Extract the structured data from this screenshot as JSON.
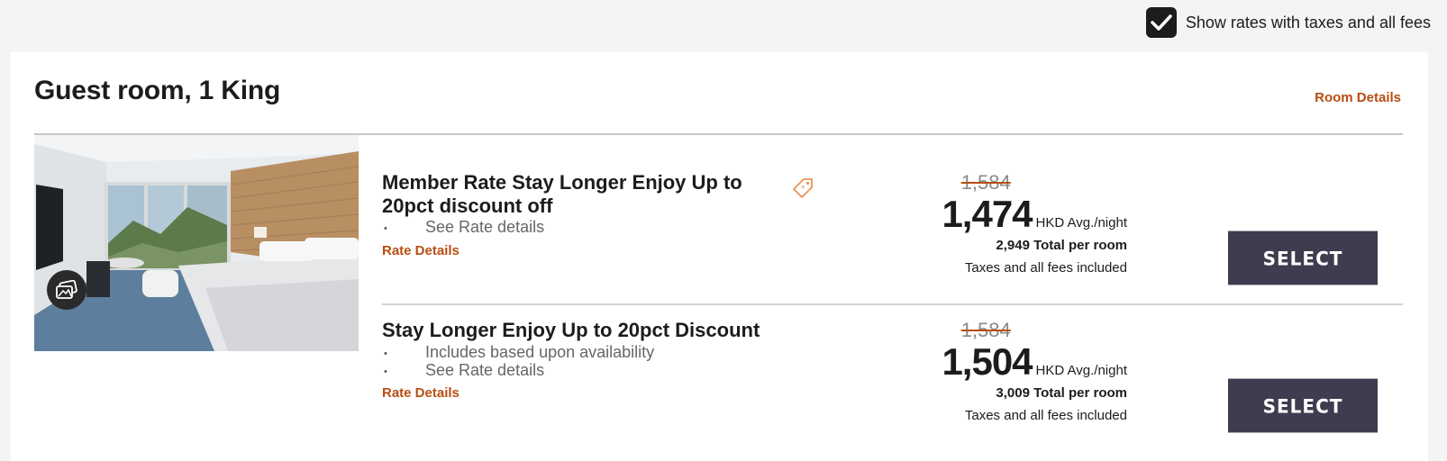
{
  "tax_toggle": {
    "label": "Show rates with taxes and all fees",
    "checked": true
  },
  "room": {
    "title": "Guest room, 1 King",
    "details_link": "Room Details"
  },
  "rates": [
    {
      "name_line1": "Member Rate Stay Longer Enjoy Up to",
      "name_line2": "20pct discount off",
      "bullets": [
        "See Rate details"
      ],
      "details_link": "Rate Details",
      "original_price": "1,584",
      "price": "1,474",
      "price_unit": "HKD Avg./night",
      "total_value": "2,949",
      "total_label": "Total per room",
      "fees_note": "Taxes and all fees included",
      "select_label": "SELECT",
      "member_tag": true
    },
    {
      "name_line1": "Stay Longer Enjoy Up to 20pct Discount",
      "bullets": [
        "Includes based upon availability",
        "See Rate details"
      ],
      "details_link": "Rate Details",
      "original_price": "1,584",
      "price": "1,504",
      "price_unit": "HKD Avg./night",
      "total_value": "3,009",
      "total_label": "Total per room",
      "fees_note": "Taxes and all fees included",
      "select_label": "SELECT",
      "member_tag": false
    }
  ],
  "icons": {
    "checkbox": "checkmark-icon",
    "gallery": "photo-gallery-icon",
    "member_tag": "price-tag-icon"
  },
  "colors": {
    "accent": "#b84d12",
    "button": "#3f3c4f",
    "text": "#1c1c1c",
    "background": "#f4f4f4"
  }
}
